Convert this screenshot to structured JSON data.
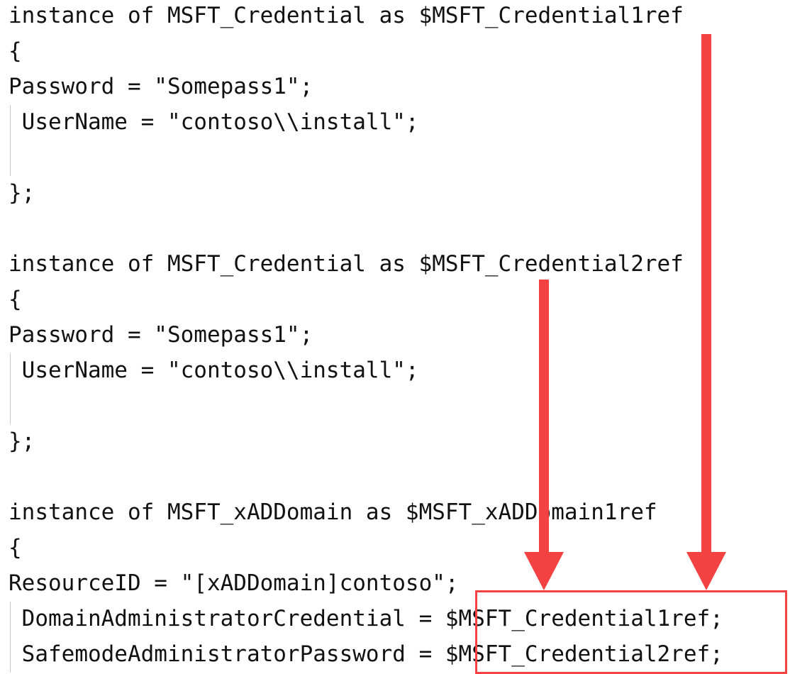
{
  "code_lines": [
    "instance of MSFT_Credential as $MSFT_Credential1ref",
    "{",
    "Password = \"Somepass1\";",
    " UserName = \"contoso\\\\install\";",
    "",
    "};",
    "",
    "instance of MSFT_Credential as $MSFT_Credential2ref",
    "{",
    "Password = \"Somepass1\";",
    " UserName = \"contoso\\\\install\";",
    "",
    "};",
    "",
    "instance of MSFT_xADDomain as $MSFT_xADDomain1ref",
    "{",
    "ResourceID = \"[xADDomain]contoso\";",
    " DomainAdministratorCredential = $MSFT_Credential1ref;",
    " SafemodeAdministratorPassword = $MSFT_Credential2ref;"
  ],
  "annotation_color": "#f44242"
}
